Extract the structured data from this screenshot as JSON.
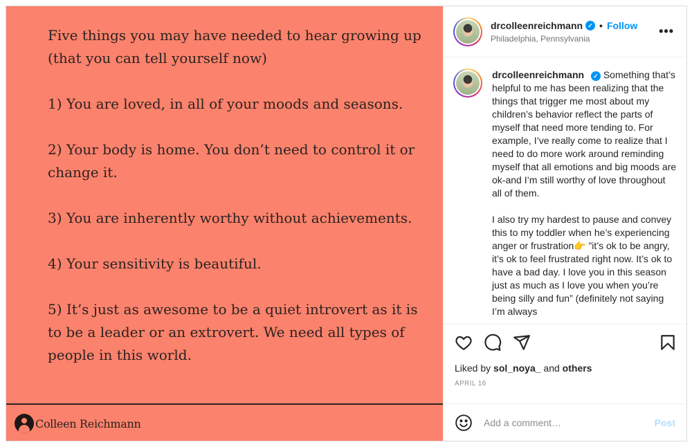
{
  "media": {
    "title": "Five things you may have needed to hear growing up (that you can tell yourself now)",
    "items": [
      "1) You are loved, in all of your moods and seasons.",
      "2) Your body is home. You don’t need to control it or change it.",
      "3) You are inherently worthy without achievements.",
      "4) Your sensitivity is beautiful.",
      "5) It’s just as awesome to be a quiet introvert as it is to be a leader or an extrovert. We need all types of people in this world."
    ],
    "credit": "Colleen Reichmann",
    "background": "#fb826c"
  },
  "header": {
    "username": "drcolleenreichmann",
    "separator": "•",
    "follow_label": "Follow",
    "location": "Philadelphia, Pennsylvania",
    "more_label": "•••"
  },
  "caption": {
    "username": "drcolleenreichmann",
    "paragraph1": "Something that’s helpful to me has been realizing that the things that trigger me most about my children’s behavior reflect the parts of myself that need more tending to. For example, I’ve really come to realize that I need to do more work around reminding myself that all emotions and big moods are ok-and I’m still worthy of love throughout all of them.",
    "paragraph2": "I also try my hardest to pause and convey this to my toddler when he’s experiencing anger or frustration👉 ”it’s ok to be angry, it’s ok to feel frustrated right now. It’s ok to have a bad day. I love you in this season just as much as I love you when you’re being silly and fun” (definitely not saying I’m always"
  },
  "actions": {
    "liked_prefix": "Liked by",
    "liked_user": "sol_noya_",
    "liked_and": "and",
    "liked_others": "others",
    "date": "APRIL 16"
  },
  "add_comment": {
    "placeholder": "Add a comment…",
    "post_label": "Post"
  },
  "colors": {
    "accent": "#0095f6",
    "post_disabled": "#b2dffc"
  }
}
